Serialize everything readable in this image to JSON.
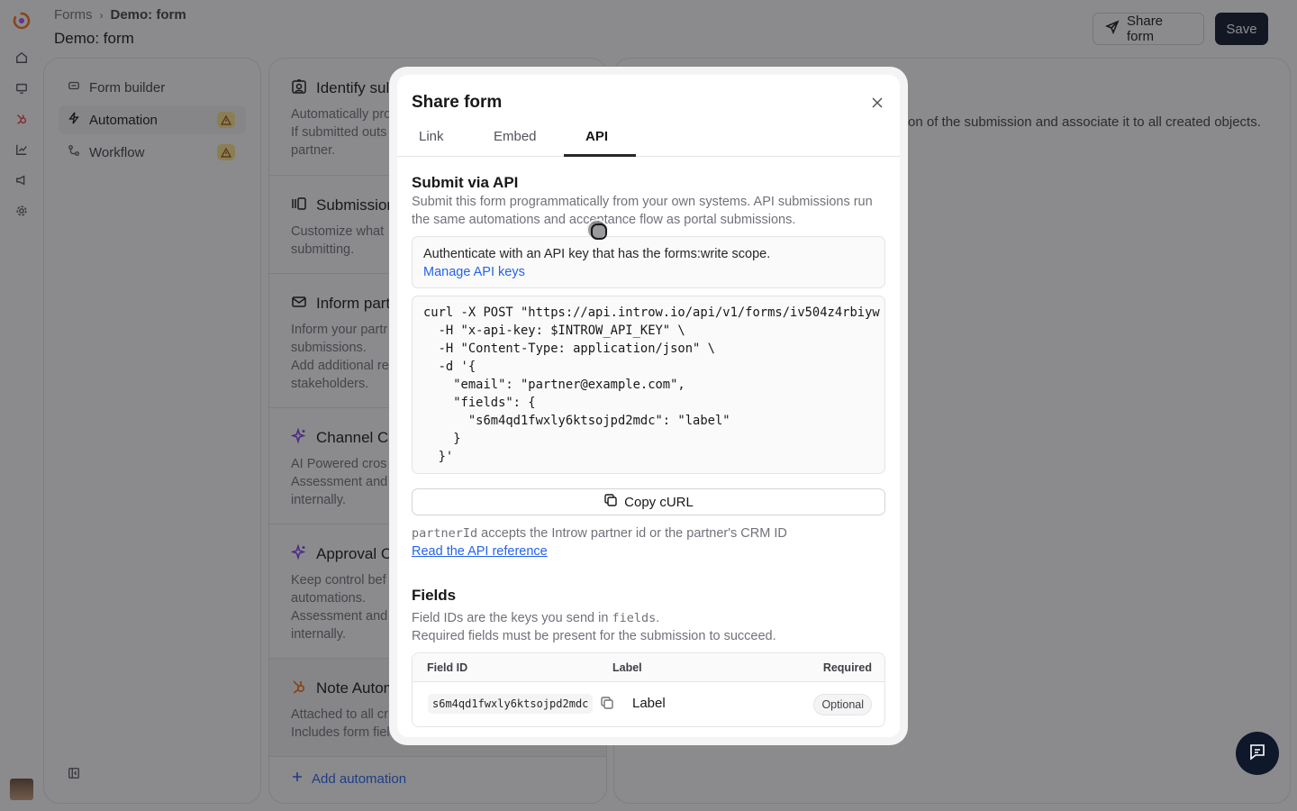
{
  "header": {
    "breadcrumb_root": "Forms",
    "breadcrumb_current": "Demo: form",
    "page_title": "Demo: form",
    "share_label": "Share form",
    "save_label": "Save"
  },
  "left_nav": {
    "items": [
      {
        "label": "Form builder",
        "icon": "form-icon",
        "warning": false
      },
      {
        "label": "Automation",
        "icon": "bolt-icon",
        "warning": true
      },
      {
        "label": "Workflow",
        "icon": "workflow-icon",
        "warning": true
      }
    ]
  },
  "automations": {
    "cards": [
      {
        "title": "Identify sul",
        "desc": "Automatically pro\nIf submitted outs\npartner."
      },
      {
        "title": "Submission",
        "desc": "Customize what\nsubmitting."
      },
      {
        "title": "Inform part",
        "desc": "Inform your partr\nsubmissions.\nAdd additional re\nstakeholders."
      },
      {
        "title": "Channel Co",
        "desc": "AI Powered cros\nAssessment and\ninternally."
      },
      {
        "title": "Approval C",
        "desc": "Keep control bef\nautomations.\nAssessment and\ninternally."
      },
      {
        "title": "Note Autom",
        "desc": "Attached to all cr\nIncludes form fiel"
      }
    ],
    "add_label": "Add automation"
  },
  "right_panel": {
    "text": "on of the submission and associate it to all created objects."
  },
  "modal": {
    "title": "Share form",
    "tabs": [
      "Link",
      "Embed",
      "API"
    ],
    "active_tab": "API",
    "submit_title": "Submit via API",
    "submit_desc": "Submit this form programmatically from your own systems. API submissions run the same automations and acceptance flow as portal submissions.",
    "auth_text": "Authenticate with an API key that has the forms:write scope.",
    "auth_link": "Manage API keys",
    "code": "curl -X POST \"https://api.introw.io/api/v1/forms/iv504z4rbiyw\n  -H \"x-api-key: $INTROW_API_KEY\" \\\n  -H \"Content-Type: application/json\" \\\n  -d '{\n    \"email\": \"partner@example.com\",\n    \"fields\": {\n      \"s6m4qd1fwxly6ktsojpd2mdc\": \"label\"\n    }\n  }'",
    "copy_label": "Copy cURL",
    "note_code": "partnerId",
    "note_text": " accepts the Introw partner id or the partner's CRM ID",
    "api_ref_link": "Read the API reference",
    "fields_title": "Fields",
    "fields_desc_1": "Field IDs are the keys you send in ",
    "fields_desc_code": "fields",
    "fields_desc_2": ".",
    "fields_desc_3": "Required fields must be present for the submission to succeed.",
    "table": {
      "headers": [
        "Field ID",
        "Label",
        "Required"
      ],
      "rows": [
        {
          "field_id": "s6m4qd1fwxly6ktsojpd2mdc",
          "label": "Label",
          "required": "Optional"
        }
      ]
    }
  },
  "colors": {
    "primary_dark": "#0f172a",
    "link_blue": "#2563eb",
    "warning_bg": "#fde68a",
    "overlay": "rgba(24,24,27,0.5)",
    "logo_orange": "#f97316"
  }
}
